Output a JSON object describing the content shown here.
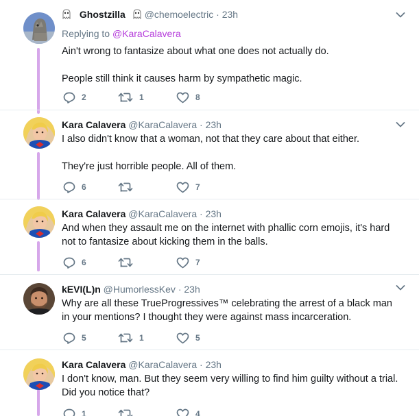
{
  "tweets": [
    {
      "name": "Ghostzilla",
      "handle": "@chemoelectric",
      "time": "23h",
      "reply_prefix": "Replying to ",
      "reply_to": "@KaraCalavera",
      "paragraphs": [
        "Ain't wrong to fantasize about what one does not actually do.",
        "People still think it causes harm by sympathetic magic."
      ],
      "replies": "2",
      "retweets": "1",
      "likes": "8"
    },
    {
      "name": "Kara Calavera",
      "handle": "@KaraCalavera",
      "time": "23h",
      "paragraphs": [
        "I also didn't know that a woman, not that they care about that either.",
        "They're just horrible people. All of them."
      ],
      "replies": "6",
      "retweets": "",
      "likes": "7"
    },
    {
      "name": "Kara Calavera",
      "handle": "@KaraCalavera",
      "time": "23h",
      "paragraphs": [
        "And when they assault me on the internet with phallic corn emojis, it's hard not to fantasize about kicking them in the balls."
      ],
      "replies": "6",
      "retweets": "",
      "likes": "7"
    },
    {
      "name": "kEVI(L)n",
      "handle": "@HumorlessKev",
      "time": "23h",
      "paragraphs": [
        "Why are all these TrueProgressives™ celebrating the arrest of a black man in your mentions? I thought they were against mass incarceration."
      ],
      "replies": "5",
      "retweets": "1",
      "likes": "5"
    },
    {
      "name": "Kara Calavera",
      "handle": "@KaraCalavera",
      "time": "23h",
      "paragraphs": [
        "I don't know, man. But they seem very willing to find him guilty without a trial. Did you notice that?"
      ],
      "replies": "1",
      "retweets": "",
      "likes": "4"
    }
  ],
  "ui": {
    "dot": "·",
    "colors": {
      "thread_line": "#d6a7ea",
      "mention": "#b53cdb",
      "icon_gray": "#657786",
      "divider": "#e6ecf0"
    },
    "icons": [
      "ghost-emoji-icon",
      "reply-icon",
      "retweet-icon",
      "like-icon",
      "chevron-down-icon"
    ]
  }
}
